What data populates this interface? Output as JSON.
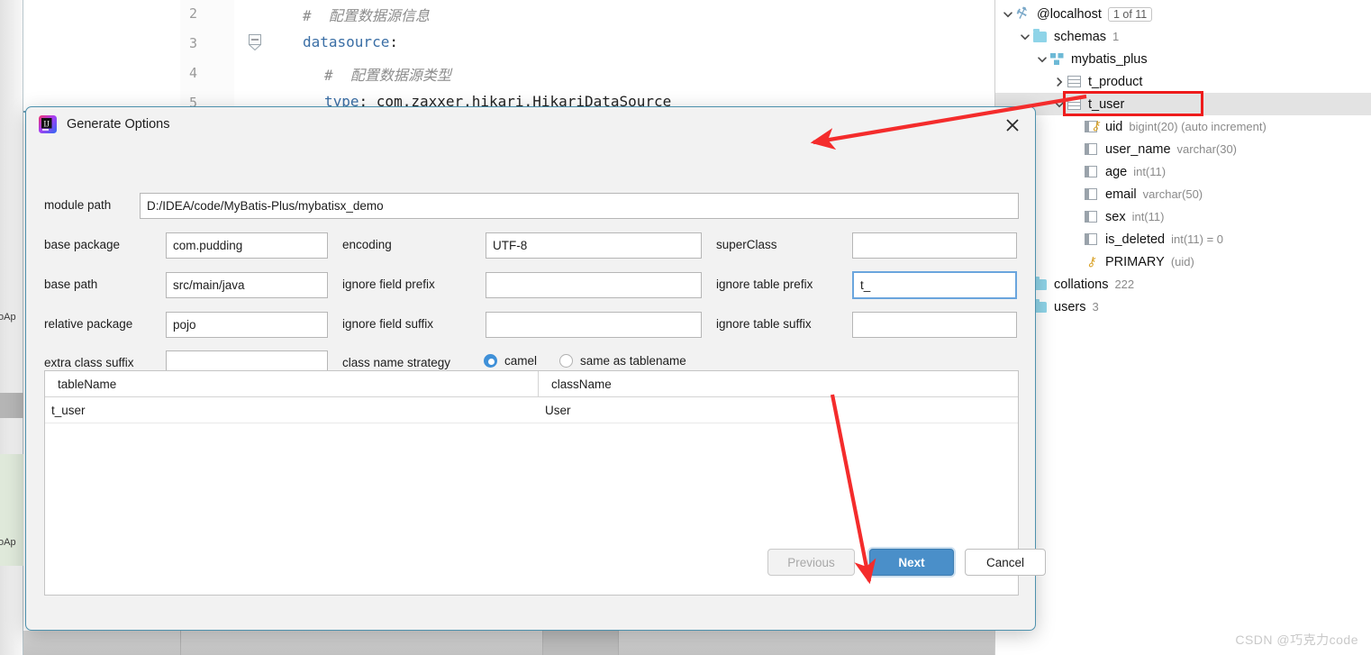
{
  "editor": {
    "lines": [
      {
        "num": "2",
        "indent": 0,
        "tokens": [
          {
            "t": "#  配置数据源信息",
            "c": "comment"
          }
        ]
      },
      {
        "num": "3",
        "indent": 0,
        "tokens": [
          {
            "t": "datasource",
            "c": "key"
          },
          {
            "t": ":",
            "c": "plain"
          }
        ],
        "fold": true
      },
      {
        "num": "4",
        "indent": 1,
        "tokens": [
          {
            "t": "#  配置数据源类型",
            "c": "comment"
          }
        ]
      },
      {
        "num": "5",
        "indent": 1,
        "tokens": [
          {
            "t": "type",
            "c": "key"
          },
          {
            "t": ": com.zaxxer.hikari.HikariDataSource",
            "c": "plain"
          }
        ]
      }
    ],
    "left_strip_labels": [
      "oAp",
      "oAp"
    ]
  },
  "db_tree": {
    "nodes": [
      {
        "indent": 0,
        "twisty": "expanded",
        "icon": "plug-icon",
        "label": "@localhost",
        "badge": "1 of 11",
        "meta": ""
      },
      {
        "indent": 1,
        "twisty": "expanded",
        "icon": "folder-icon",
        "label": "schemas",
        "badge": "",
        "meta": "1"
      },
      {
        "indent": 2,
        "twisty": "expanded",
        "icon": "schema-icon",
        "label": "mybatis_plus",
        "badge": "",
        "meta": ""
      },
      {
        "indent": 3,
        "twisty": "collapsed",
        "icon": "table-icon",
        "label": "t_product",
        "badge": "",
        "meta": ""
      },
      {
        "indent": 3,
        "twisty": "expanded",
        "icon": "table-icon",
        "label": "t_user",
        "badge": "",
        "meta": "",
        "selected": true,
        "highlighted": true
      },
      {
        "indent": 4,
        "twisty": "none",
        "icon": "pk-column-icon",
        "label": "uid",
        "badge": "",
        "meta": "bigint(20) (auto increment)"
      },
      {
        "indent": 4,
        "twisty": "none",
        "icon": "column-icon",
        "label": "user_name",
        "badge": "",
        "meta": "varchar(30)"
      },
      {
        "indent": 4,
        "twisty": "none",
        "icon": "column-icon",
        "label": "age",
        "badge": "",
        "meta": "int(11)"
      },
      {
        "indent": 4,
        "twisty": "none",
        "icon": "column-icon",
        "label": "email",
        "badge": "",
        "meta": "varchar(50)"
      },
      {
        "indent": 4,
        "twisty": "none",
        "icon": "column-icon",
        "label": "sex",
        "badge": "",
        "meta": "int(11)"
      },
      {
        "indent": 4,
        "twisty": "none",
        "icon": "column-icon",
        "label": "is_deleted",
        "badge": "",
        "meta": "int(11) = 0"
      },
      {
        "indent": 4,
        "twisty": "none",
        "icon": "key-icon",
        "label": "PRIMARY",
        "badge": "",
        "meta": "(uid)"
      },
      {
        "indent": 1,
        "twisty": "none",
        "icon": "folder-icon",
        "label": "collations",
        "badge": "",
        "meta": "222"
      },
      {
        "indent": 1,
        "twisty": "none",
        "icon": "folder-icon",
        "label": "users",
        "badge": "",
        "meta": "3"
      }
    ]
  },
  "dialog": {
    "title": "Generate Options",
    "close_icon": "close-icon",
    "app_icon": "intellij-idea-icon",
    "fields": {
      "module_path": {
        "label": "module path",
        "value": "D:/IDEA/code/MyBatis-Plus/mybatisx_demo",
        "placeholder": ""
      },
      "base_package": {
        "label": "base package",
        "value": "com.pudding",
        "placeholder": ""
      },
      "base_path": {
        "label": "base path",
        "value": "src/main/java",
        "placeholder": ""
      },
      "relative_package": {
        "label": "relative package",
        "value": "pojo",
        "placeholder": ""
      },
      "extra_class_suffix": {
        "label": "extra class suffix",
        "value": "",
        "placeholder": ""
      },
      "encoding": {
        "label": "encoding",
        "value": "UTF-8",
        "placeholder": ""
      },
      "ignore_field_prefix": {
        "label": "ignore field prefix",
        "value": "",
        "placeholder": ""
      },
      "ignore_field_suffix": {
        "label": "ignore field suffix",
        "value": "",
        "placeholder": ""
      },
      "super_class": {
        "label": "superClass",
        "value": "",
        "placeholder": ""
      },
      "ignore_table_prefix": {
        "label": "ignore table prefix",
        "value": "t_",
        "placeholder": "",
        "focused": true
      },
      "ignore_table_suffix": {
        "label": "ignore table suffix",
        "value": "",
        "placeholder": ""
      }
    },
    "class_name_strategy": {
      "label": "class name strategy",
      "options": [
        {
          "label": "camel",
          "selected": true
        },
        {
          "label": "same as tablename",
          "selected": false
        }
      ]
    },
    "table": {
      "columns": [
        "tableName",
        "className"
      ],
      "rows": [
        {
          "tableName": "t_user",
          "className": "User"
        }
      ]
    },
    "buttons": {
      "previous": {
        "label": "Previous",
        "disabled": true
      },
      "next": {
        "label": "Next",
        "primary": true
      },
      "cancel": {
        "label": "Cancel"
      }
    }
  },
  "annotations": {
    "arrow_to_dialog_title": "red-arrow-icon",
    "arrow_to_next_button": "red-arrow-icon",
    "highlight_box_t_user": "red-highlight-box"
  },
  "watermark": {
    "text": "CSDN @巧克力code"
  },
  "colors": {
    "accent": "#4a8fc9",
    "annotation": "#ee1c1c",
    "dialog_border": "#4d91ad",
    "focus_border": "#6aa5dd"
  }
}
